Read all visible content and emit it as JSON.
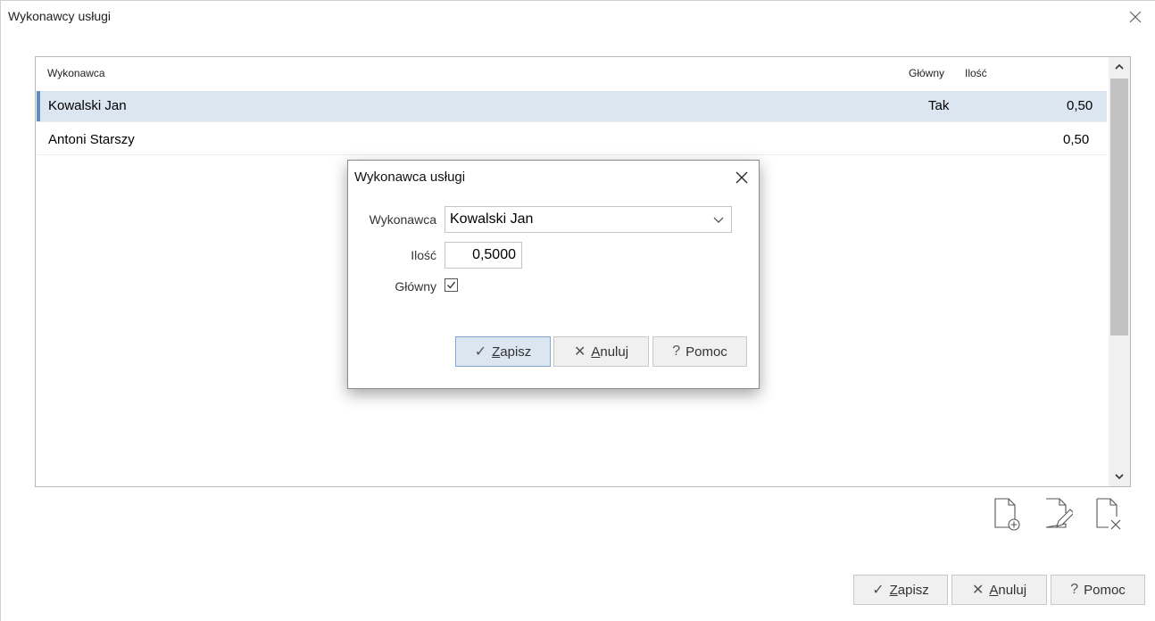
{
  "window": {
    "title": "Wykonawcy usługi",
    "close_icon": "close-icon"
  },
  "grid": {
    "columns": [
      "Wykonawca",
      "Główny",
      "Ilość"
    ],
    "rows": [
      {
        "wykonawca": "Kowalski Jan",
        "glowny": "Tak",
        "ilosc": "0,50",
        "selected": true
      },
      {
        "wykonawca": "Antoni Starszy",
        "glowny": "",
        "ilosc": "0,50",
        "selected": false
      }
    ]
  },
  "toolbar": {
    "add_icon": "document-add-icon",
    "edit_icon": "document-edit-icon",
    "delete_icon": "document-delete-icon"
  },
  "footer": {
    "save_prefix": "",
    "save_mnemonic": "Z",
    "save_rest": "apisz",
    "cancel_mnemonic": "A",
    "cancel_rest": "nuluj",
    "help_label": "Pomoc"
  },
  "dialog": {
    "title": "Wykonawca usługi",
    "wykonawca_label": "Wykonawca",
    "wykonawca_value": "Kowalski Jan",
    "ilosc_label": "Ilość",
    "ilosc_value": "0,5000",
    "glowny_label": "Główny",
    "glowny_checked": true,
    "save_mnemonic": "Z",
    "save_rest": "apisz",
    "cancel_mnemonic": "A",
    "cancel_rest": "nuluj",
    "help_label": "Pomoc"
  },
  "colors": {
    "selection": "#dce6f1",
    "selection_marker": "#5b8ec7",
    "primary_button": "#dce6f1"
  }
}
